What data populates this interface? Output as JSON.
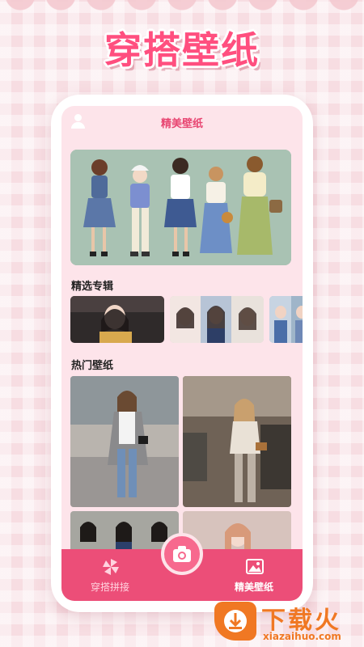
{
  "promo": {
    "title": "穿搭壁纸"
  },
  "app": {
    "header_title": "精美壁纸",
    "sections": {
      "albums_title": "精选专辑",
      "hot_title": "热门壁纸"
    },
    "tabs": [
      {
        "label": "穿搭拼接",
        "icon": "pinwheel-icon",
        "active": false
      },
      {
        "label": "精美壁纸",
        "icon": "image-icon",
        "active": true
      }
    ],
    "center_button_icon": "camera-icon"
  },
  "watermark": {
    "text": "下载火",
    "sub": "xiazaihuo.com"
  },
  "colors": {
    "accent": "#ec4e78",
    "title_pink": "#ff4f7f",
    "screen_bg": "#fde4ea",
    "watermark_orange": "#f07823"
  }
}
